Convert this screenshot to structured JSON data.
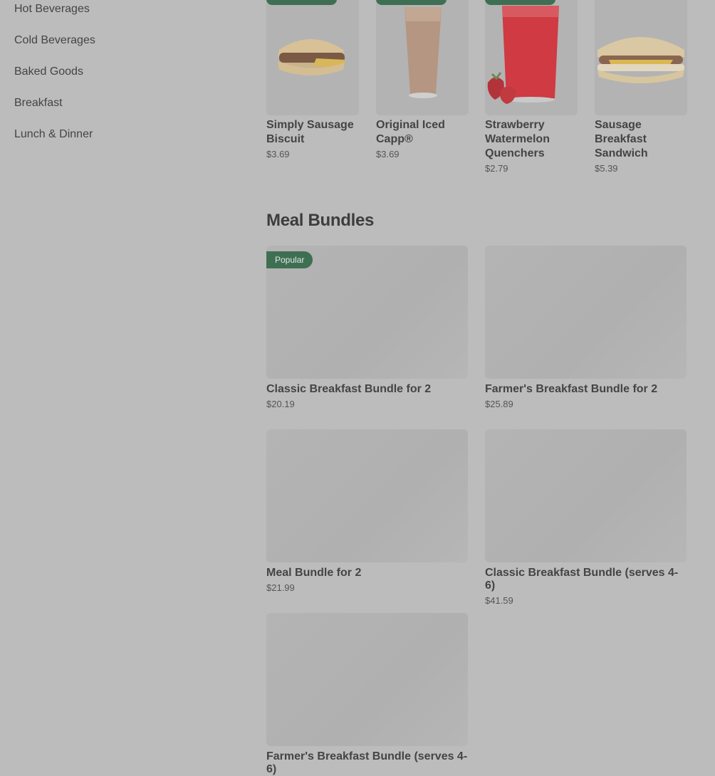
{
  "sidebar": {
    "items": [
      {
        "label": "Hot Beverages"
      },
      {
        "label": "Cold Beverages"
      },
      {
        "label": "Baked Goods"
      },
      {
        "label": "Breakfast"
      },
      {
        "label": "Lunch & Dinner"
      }
    ]
  },
  "popular": {
    "items": [
      {
        "name": "Simply Sausage Biscuit",
        "price": "$3.69",
        "image": "sausage-biscuit"
      },
      {
        "name": "Original Iced Capp®",
        "price": "$3.69",
        "image": "iced-capp"
      },
      {
        "name": "Strawberry Watermelon Quenchers",
        "price": "$2.79",
        "image": "strawberry-quencher"
      },
      {
        "name": "Sausage Breakfast Sandwich",
        "price": "$5.39",
        "image": "breakfast-sandwich"
      }
    ]
  },
  "bundles": {
    "title": "Meal Bundles",
    "items": [
      {
        "name": "Classic Breakfast Bundle for 2",
        "price": "$20.19",
        "badge": "Popular"
      },
      {
        "name": "Farmer's Breakfast Bundle for 2",
        "price": "$25.89"
      },
      {
        "name": "Meal Bundle for 2",
        "price": "$21.99"
      },
      {
        "name": "Classic Breakfast Bundle (serves 4-6)",
        "price": "$41.59"
      },
      {
        "name": "Farmer's Breakfast Bundle (serves 4-6)",
        "price": ""
      }
    ]
  },
  "colors": {
    "overlay": "#bcbcbc",
    "accent": "#3f6f52"
  }
}
